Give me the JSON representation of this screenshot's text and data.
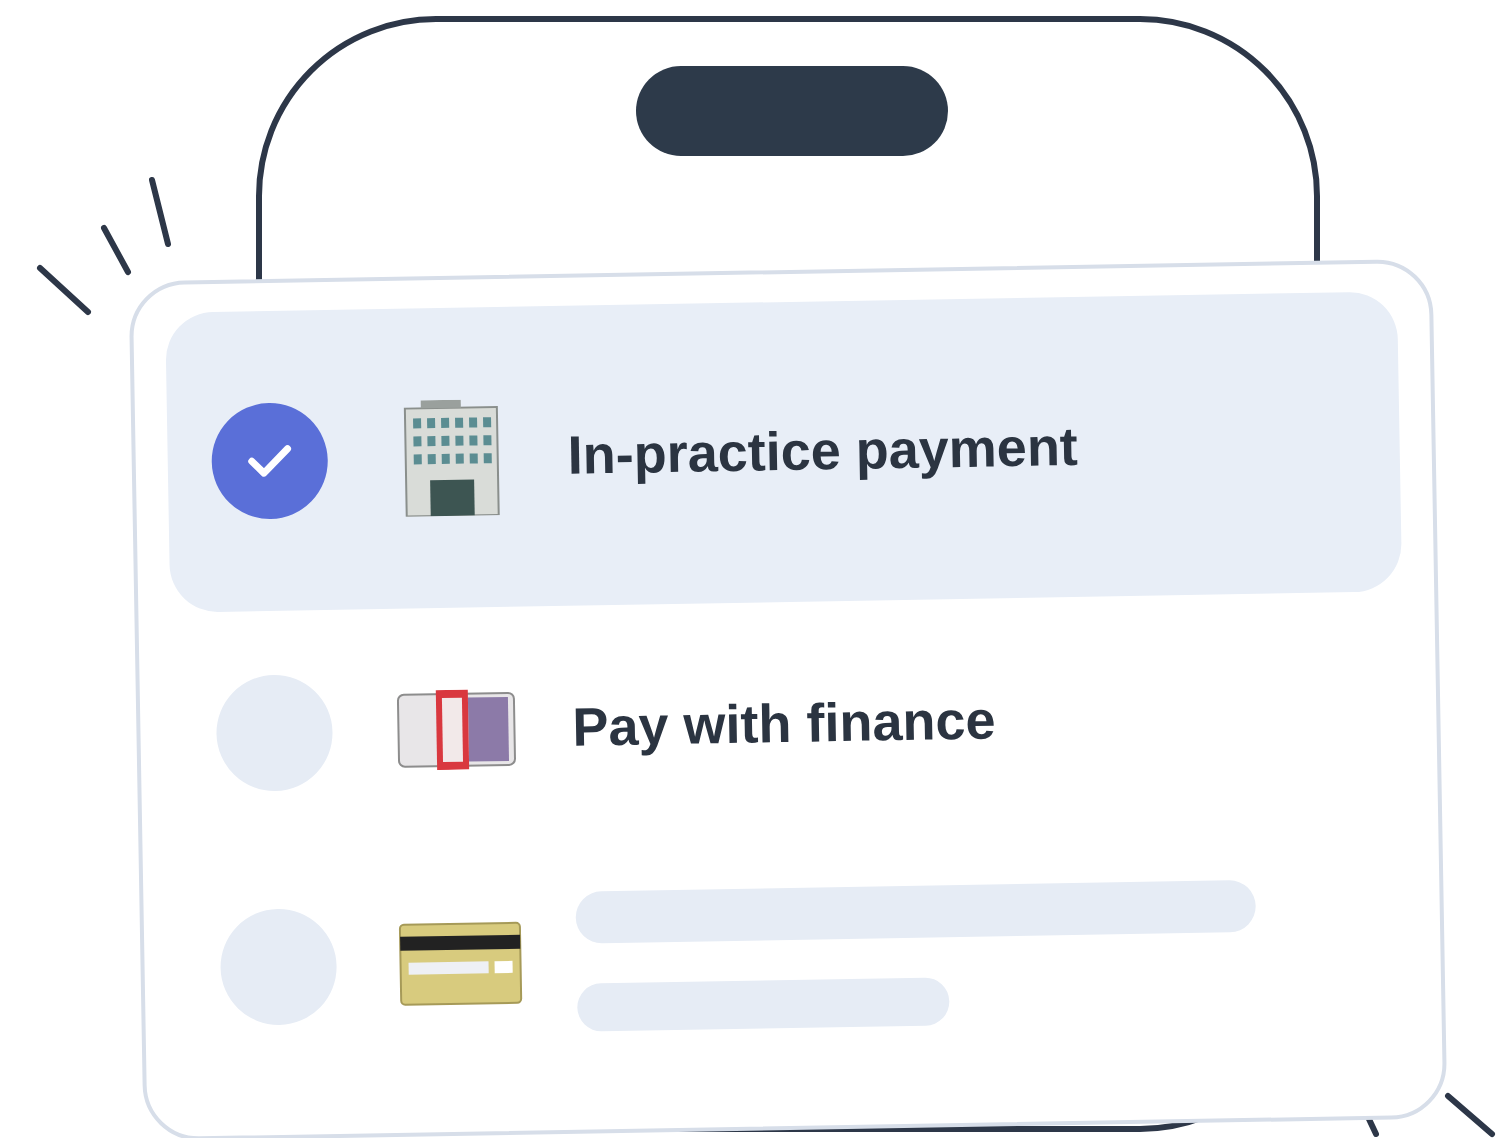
{
  "options": [
    {
      "kind": "label",
      "label": "In-practice payment",
      "selected": true
    },
    {
      "kind": "label",
      "label": "Pay with finance",
      "selected": false
    },
    {
      "kind": "skeleton",
      "selected": false
    }
  ]
}
